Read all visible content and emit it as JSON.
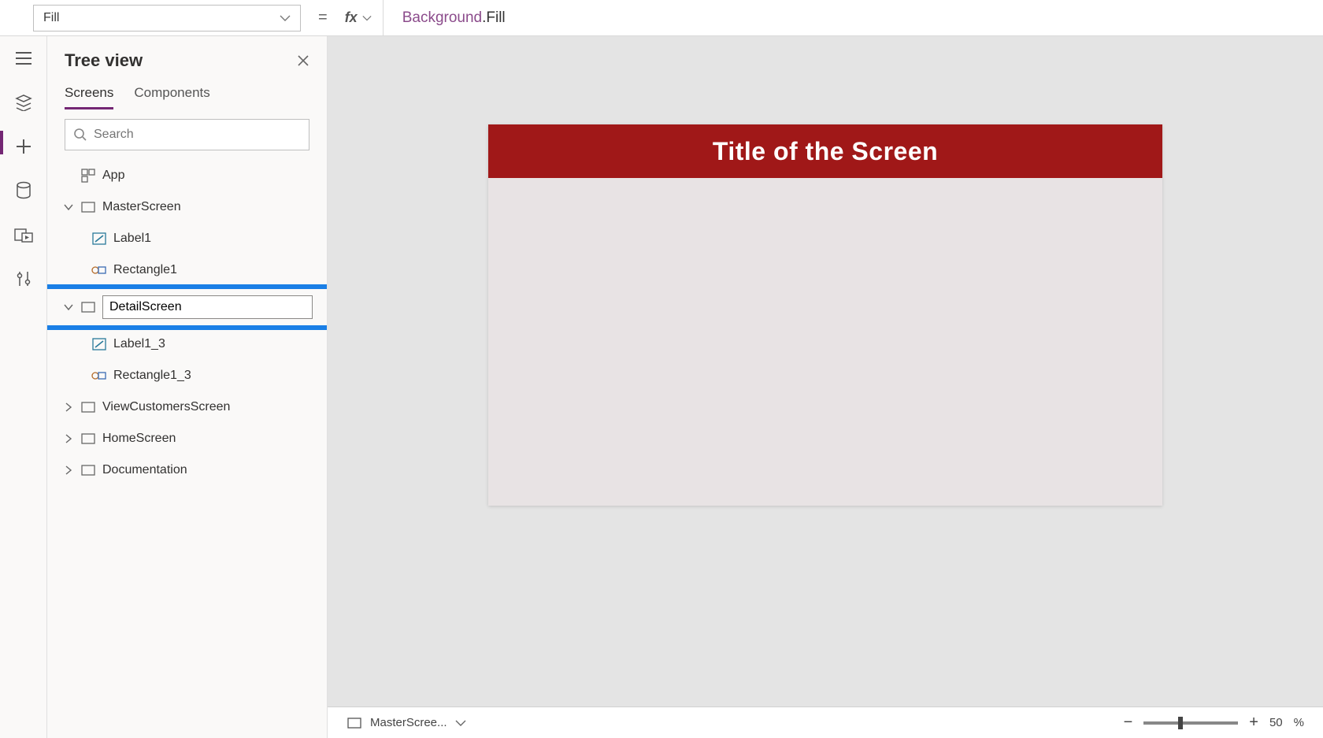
{
  "formula": {
    "property": "Fill",
    "control": "Background",
    "dotprop": ".Fill"
  },
  "tree": {
    "title": "Tree view",
    "tab_screens": "Screens",
    "tab_components": "Components",
    "search_placeholder": "Search",
    "app_label": "App",
    "items": [
      {
        "label": "MasterScreen"
      },
      {
        "label": "Label1"
      },
      {
        "label": "Rectangle1"
      },
      {
        "edit_value": "DetailScreen"
      },
      {
        "label": "Label1_3"
      },
      {
        "label": "Rectangle1_3"
      },
      {
        "label": "ViewCustomersScreen"
      },
      {
        "label": "HomeScreen"
      },
      {
        "label": "Documentation"
      }
    ]
  },
  "canvas": {
    "header_title": "Title of the Screen"
  },
  "status": {
    "selected": "MasterScree...",
    "zoom_pct": "50",
    "zoom_symbol": "%"
  }
}
